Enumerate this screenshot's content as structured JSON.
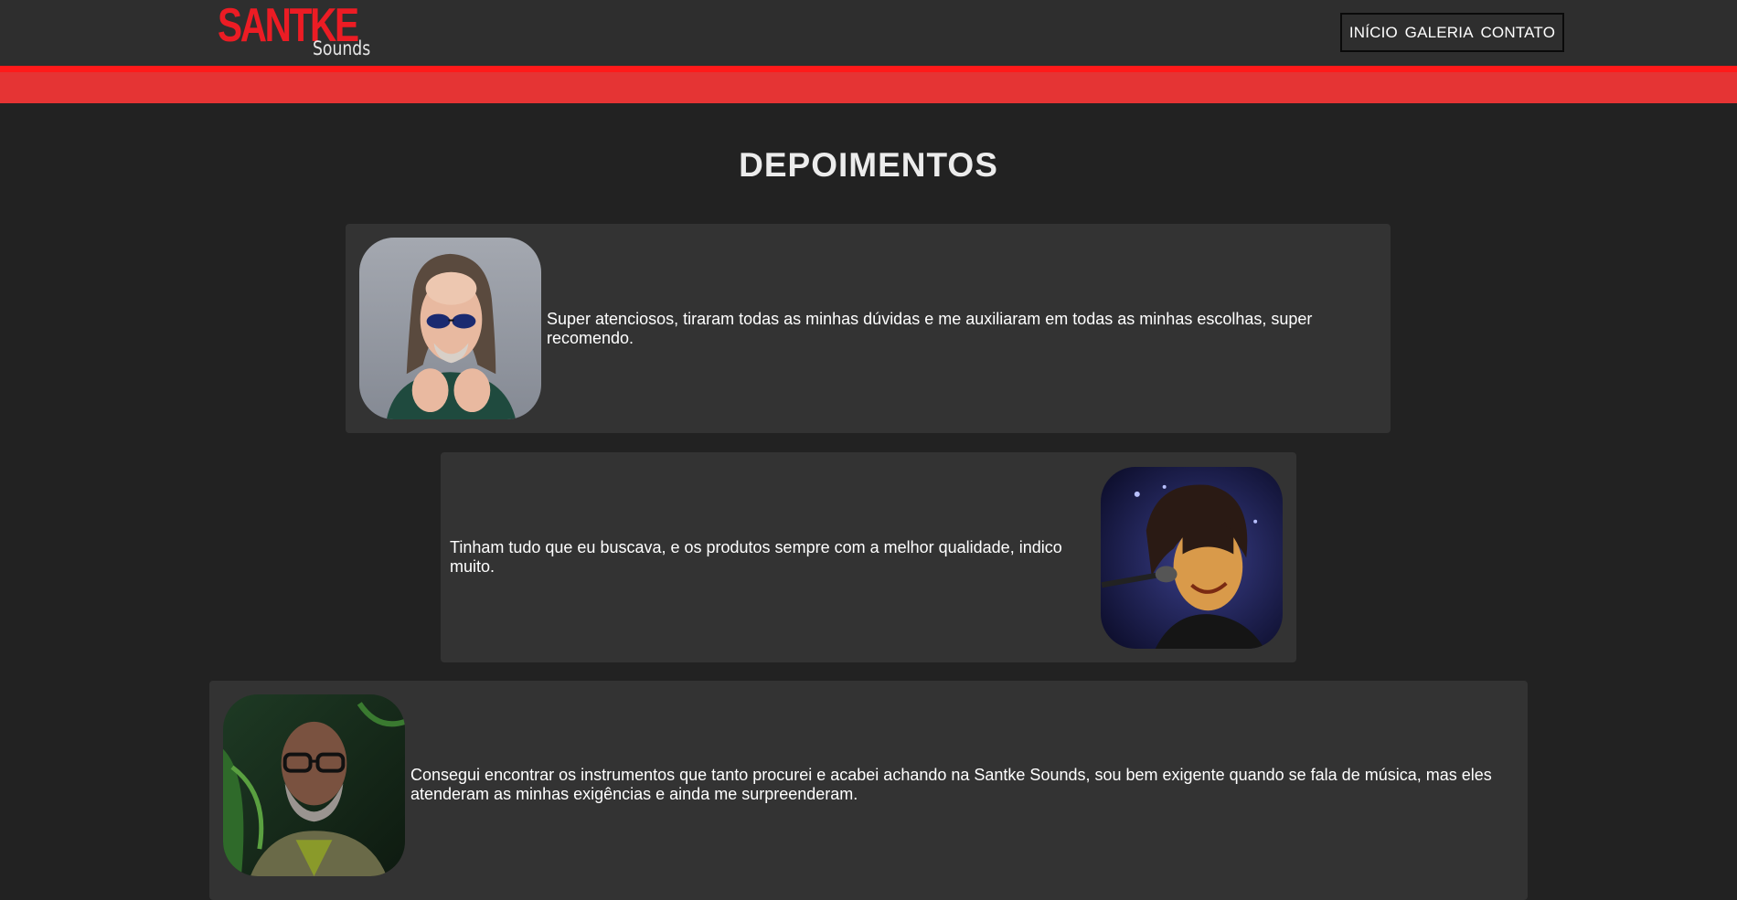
{
  "header": {
    "logo_main": "SANTKE",
    "logo_sub": "Sounds",
    "nav": [
      {
        "label": "INÍCIO"
      },
      {
        "label": "GALERIA"
      },
      {
        "label": "CONTATO"
      }
    ]
  },
  "section": {
    "title": "DEPOIMENTOS"
  },
  "testimonials": [
    {
      "text": "Super atenciosos, tiraram todas as minhas dúvidas e me auxiliaram em todas as minhas escolhas, super recomendo.",
      "photo": "man-long-hair-sunglasses-photo"
    },
    {
      "text": "Tinham tudo que eu buscava, e os produtos sempre com a melhor qualidade, indico muito.",
      "photo": "singer-with-microphone-photo"
    },
    {
      "text": "Consegui encontrar os instrumentos que tanto procurei e acabei achando na Santke Sounds, sou bem exigente quando se fala de música, mas eles atenderam as minhas exigências e ainda me surpreenderam.",
      "photo": "bald-man-glasses-beard-photo"
    }
  ],
  "colors": {
    "page_bg": "#222222",
    "header_bg": "#2e2e2e",
    "card_bg": "#333333",
    "brand_red": "#ec1c24",
    "band_red": "#e53434"
  }
}
